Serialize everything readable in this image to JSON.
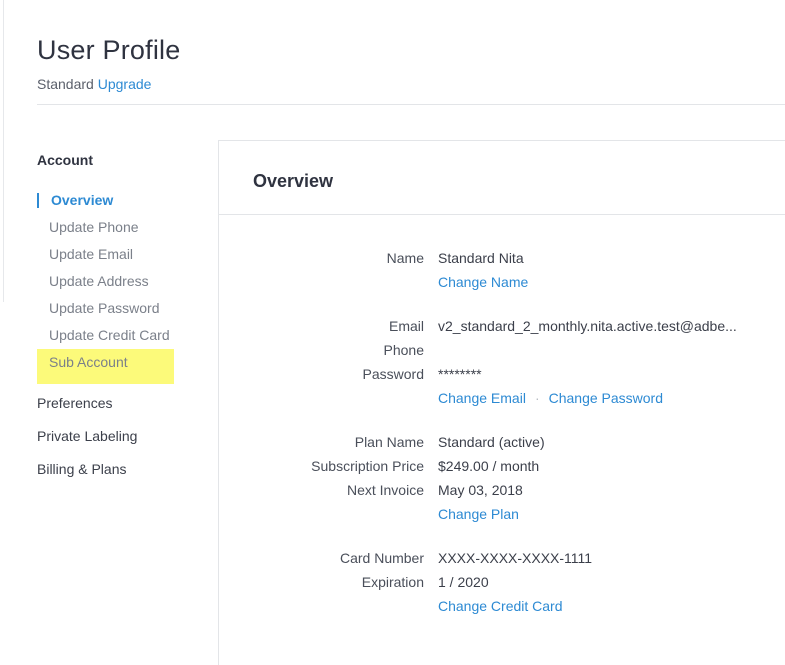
{
  "header": {
    "title": "User Profile",
    "plan_label": "Standard",
    "upgrade_label": "Upgrade"
  },
  "sidebar": {
    "account_heading": "Account",
    "items": [
      {
        "label": "Overview",
        "active": true
      },
      {
        "label": "Update Phone"
      },
      {
        "label": "Update Email"
      },
      {
        "label": "Update Address"
      },
      {
        "label": "Update Password"
      },
      {
        "label": "Update Credit Card"
      },
      {
        "label": "Sub Account",
        "highlighted": true
      }
    ],
    "sections": [
      "Preferences",
      "Private Labeling",
      "Billing & Plans"
    ]
  },
  "panel": {
    "title": "Overview",
    "name_label": "Name",
    "name_value": "Standard Nita",
    "change_name": "Change Name",
    "email_label": "Email",
    "email_value": "v2_standard_2_monthly.nita.active.test@adbe...",
    "phone_label": "Phone",
    "phone_value": "",
    "password_label": "Password",
    "password_value": "********",
    "change_email": "Change Email",
    "separator": "·",
    "change_password": "Change Password",
    "plan_name_label": "Plan Name",
    "plan_name_value": "Standard (active)",
    "price_label": "Subscription Price",
    "price_value": "$249.00 / month",
    "next_invoice_label": "Next Invoice",
    "next_invoice_value": "May 03, 2018",
    "change_plan": "Change Plan",
    "card_number_label": "Card Number",
    "card_number_value": "XXXX-XXXX-XXXX-1111",
    "expiration_label": "Expiration",
    "expiration_value": "1 / 2020",
    "change_card": "Change Credit Card"
  },
  "colors": {
    "accent": "#2d8ad3",
    "highlight": "#fcfa7a",
    "divider": "#e3e5e8"
  }
}
